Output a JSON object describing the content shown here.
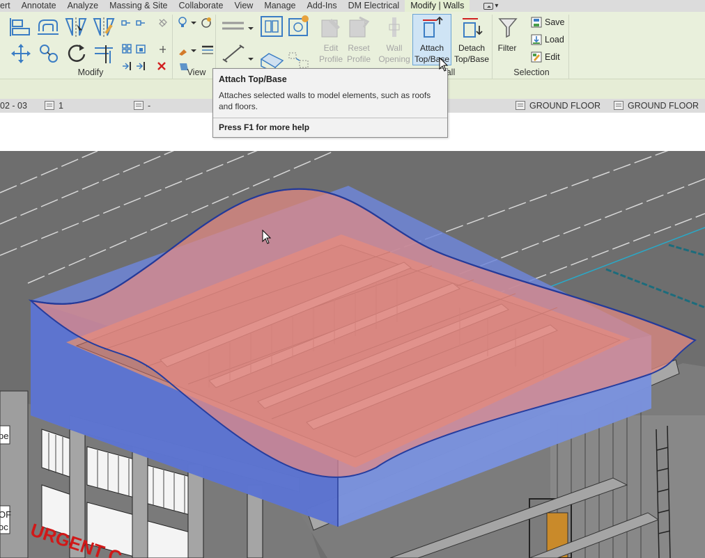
{
  "tabs": {
    "items": [
      "ert",
      "Annotate",
      "Analyze",
      "Massing & Site",
      "Collaborate",
      "View",
      "Manage",
      "Add-Ins",
      "DM Electrical"
    ],
    "active": "Modify | Walls"
  },
  "ribbon": {
    "panels": {
      "modify": "Modify",
      "view": "View",
      "wall": "all",
      "selection": "Selection"
    },
    "buttons": {
      "edit_profile": "Edit Profile",
      "reset_profile": "Reset Profile",
      "wall_opening": "Wall Opening",
      "attach_top_base": "Attach Top/Base",
      "detach_top_base": "Detach Top/Base",
      "filter": "Filter",
      "save": "Save",
      "load": "Load",
      "edit": "Edit"
    },
    "colors": {
      "ribbon_bg": "#e9f0dc",
      "active_tab": "#e5efd3",
      "active_button": "#cfe4f5"
    }
  },
  "optbar": {
    "phase": "02 - 03",
    "count": "1",
    "dash": "-",
    "level_1": "GROUND FLOOR",
    "level_2": "GROUND FLOOR"
  },
  "tooltip": {
    "title": "Attach Top/Base",
    "description": "Attaches selected walls to model elements, such as roofs and floors.",
    "help": "Press F1 for more help"
  },
  "viewport": {
    "sign_text": "URGENT C",
    "side_label_1": "pe",
    "side_label_2": "OF",
    "side_label_3": "oc"
  }
}
